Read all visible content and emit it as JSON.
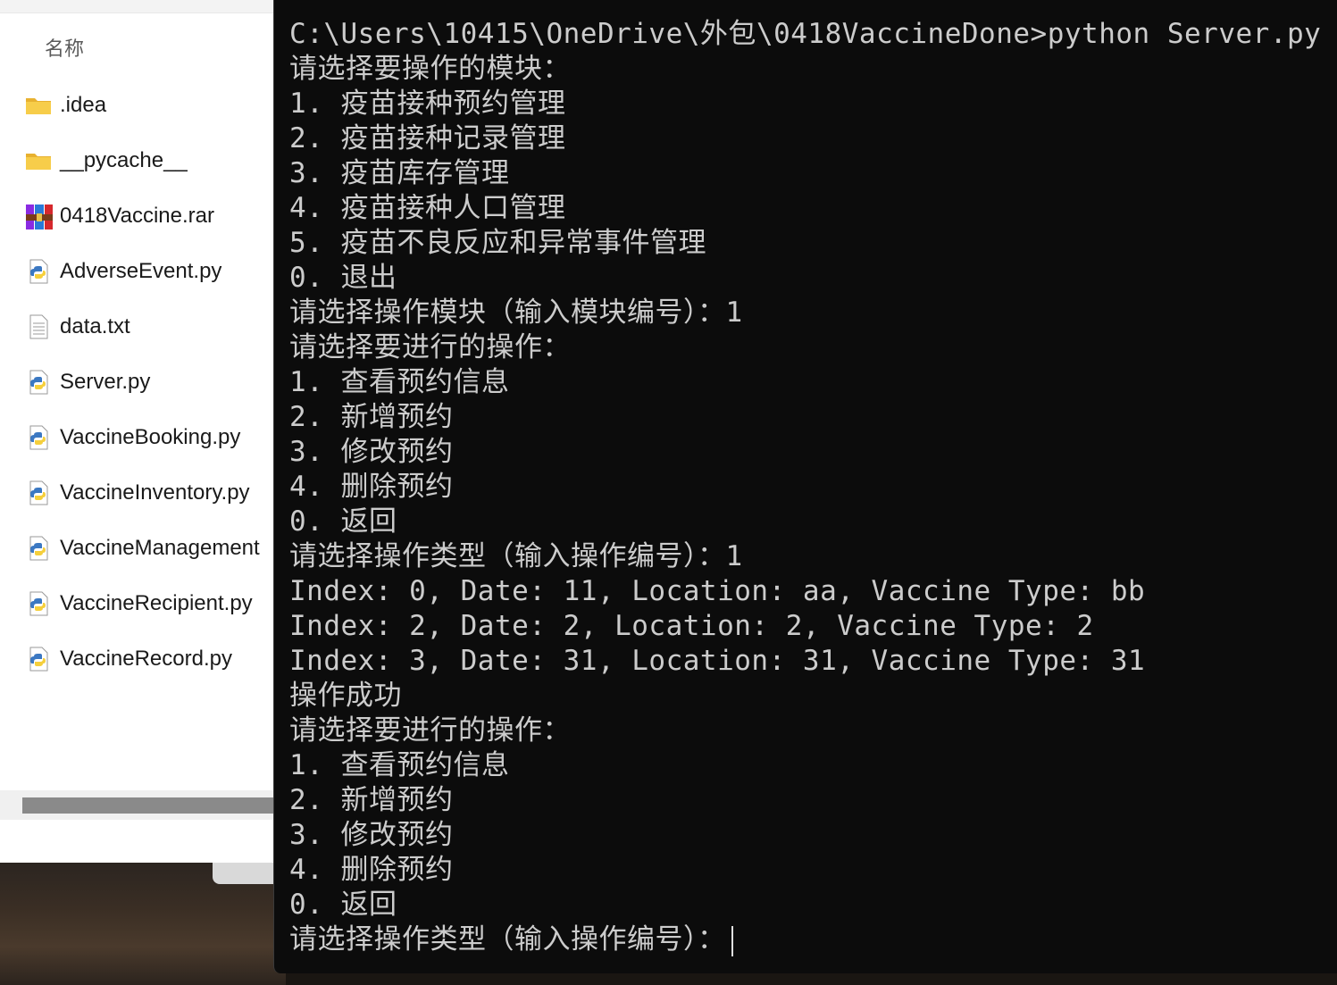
{
  "explorer": {
    "column_header": "名称",
    "files": [
      {
        "name": ".idea",
        "icon": "folder-icon"
      },
      {
        "name": "__pycache__",
        "icon": "folder-icon"
      },
      {
        "name": "0418Vaccine.rar",
        "icon": "rar-archive-icon"
      },
      {
        "name": "AdverseEvent.py",
        "icon": "python-file-icon"
      },
      {
        "name": "data.txt",
        "icon": "text-file-icon"
      },
      {
        "name": "Server.py",
        "icon": "python-file-icon"
      },
      {
        "name": "VaccineBooking.py",
        "icon": "python-file-icon"
      },
      {
        "name": "VaccineInventory.py",
        "icon": "python-file-icon"
      },
      {
        "name": "VaccineManagement",
        "icon": "python-file-icon"
      },
      {
        "name": "VaccineRecipient.py",
        "icon": "python-file-icon"
      },
      {
        "name": "VaccineRecord.py",
        "icon": "python-file-icon"
      }
    ]
  },
  "terminal": {
    "lines": [
      "C:\\Users\\10415\\OneDrive\\外包\\0418VaccineDone>python Server.py",
      "请选择要操作的模块：",
      "1. 疫苗接种预约管理",
      "2. 疫苗接种记录管理",
      "3. 疫苗库存管理",
      "4. 疫苗接种人口管理",
      "5. 疫苗不良反应和异常事件管理",
      "0. 退出",
      "请选择操作模块（输入模块编号）：1",
      "请选择要进行的操作：",
      "1. 查看预约信息",
      "2. 新增预约",
      "3. 修改预约",
      "4. 删除预约",
      "0. 返回",
      "请选择操作类型（输入操作编号）：1",
      "Index: 0, Date: 11, Location: aa, Vaccine Type: bb",
      "Index: 2, Date: 2, Location: 2, Vaccine Type: 2",
      "Index: 3, Date: 31, Location: 31, Vaccine Type: 31",
      "操作成功",
      "请选择要进行的操作：",
      "1. 查看预约信息",
      "2. 新增预约",
      "3. 修改预约",
      "4. 删除预约",
      "0. 返回"
    ],
    "prompt_line": "请选择操作类型（输入操作编号）："
  },
  "colors": {
    "terminal_bg": "#0c0c0c",
    "terminal_fg": "#cccccc",
    "folder": "#f4c542",
    "python_blue": "#3b78c2",
    "python_yellow": "#f5cf3c"
  }
}
